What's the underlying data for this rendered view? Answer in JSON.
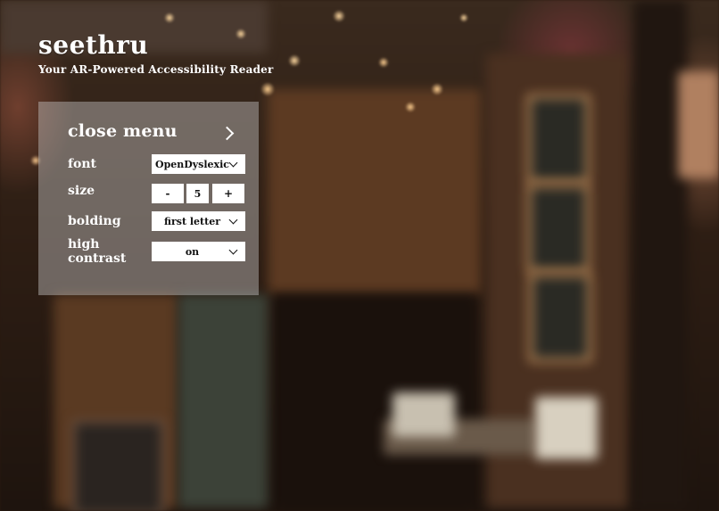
{
  "app": {
    "title": "seethru",
    "subtitle": "Your AR-Powered Accessibility Reader"
  },
  "menu": {
    "close_label": "close menu",
    "rows": {
      "font": {
        "label": "font",
        "value": "OpenDyslexic"
      },
      "size": {
        "label": "size",
        "minus": "-",
        "value": "5",
        "plus": "+"
      },
      "bolding": {
        "label": "bolding",
        "value": "first letter"
      },
      "contrast": {
        "label": "high contrast",
        "value": "on"
      }
    }
  },
  "icons": {
    "close_menu": "chevron-right-icon",
    "dropdown": "chevron-down-icon"
  },
  "colors": {
    "panel": "#cdcdcd",
    "text": "#ffffff",
    "control_bg": "#ffffff"
  }
}
